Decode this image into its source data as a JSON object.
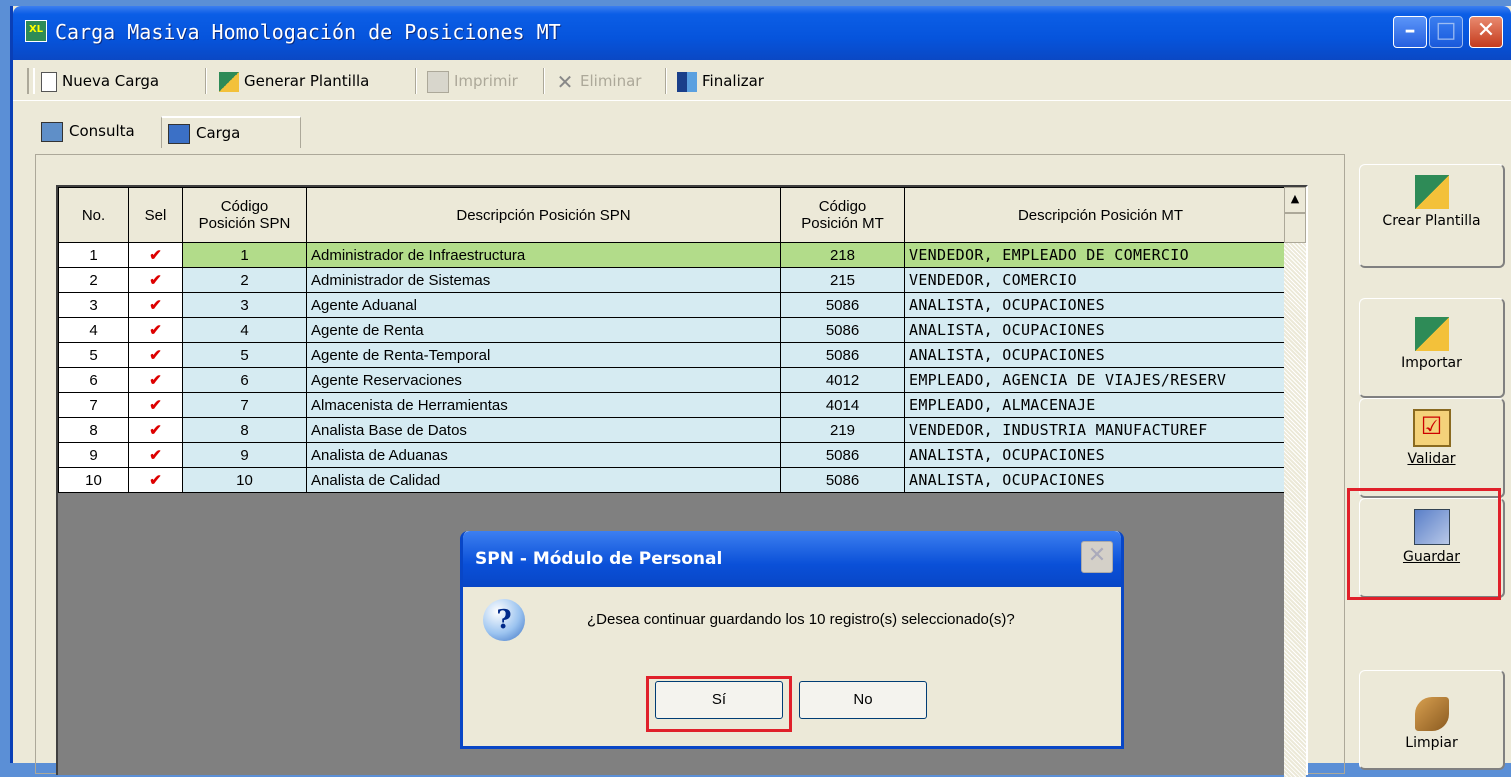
{
  "window": {
    "title": "Carga Masiva Homologación de Posiciones MT"
  },
  "toolbar": {
    "nueva_carga": "Nueva Carga",
    "generar_plantilla": "Generar Plantilla",
    "imprimir": "Imprimir",
    "eliminar": "Eliminar",
    "finalizar": "Finalizar"
  },
  "tabs": [
    {
      "label": "Consulta"
    },
    {
      "label": "Carga"
    }
  ],
  "grid": {
    "headers": [
      "No.",
      "Sel",
      "Código\nPosición SPN",
      "Descripción Posición SPN",
      "Código\nPosición MT",
      "Descripción Posición MT"
    ],
    "rows": [
      {
        "no": "1",
        "sel": "✔",
        "spn_code": "1",
        "spn_desc": "Administrador de Infraestructura",
        "mt_code": "218",
        "mt_desc": "VENDEDOR, EMPLEADO DE COMERCIO"
      },
      {
        "no": "2",
        "sel": "✔",
        "spn_code": "2",
        "spn_desc": "Administrador de Sistemas",
        "mt_code": "215",
        "mt_desc": "VENDEDOR, COMERCIO"
      },
      {
        "no": "3",
        "sel": "✔",
        "spn_code": "3",
        "spn_desc": "Agente Aduanal",
        "mt_code": "5086",
        "mt_desc": "ANALISTA, OCUPACIONES"
      },
      {
        "no": "4",
        "sel": "✔",
        "spn_code": "4",
        "spn_desc": "Agente de Renta",
        "mt_code": "5086",
        "mt_desc": "ANALISTA, OCUPACIONES"
      },
      {
        "no": "5",
        "sel": "✔",
        "spn_code": "5",
        "spn_desc": "Agente de Renta-Temporal",
        "mt_code": "5086",
        "mt_desc": "ANALISTA, OCUPACIONES"
      },
      {
        "no": "6",
        "sel": "✔",
        "spn_code": "6",
        "spn_desc": "Agente Reservaciones",
        "mt_code": "4012",
        "mt_desc": "EMPLEADO, AGENCIA DE VIAJES/RESERV"
      },
      {
        "no": "7",
        "sel": "✔",
        "spn_code": "7",
        "spn_desc": "Almacenista de Herramientas",
        "mt_code": "4014",
        "mt_desc": "EMPLEADO, ALMACENAJE"
      },
      {
        "no": "8",
        "sel": "✔",
        "spn_code": "8",
        "spn_desc": "Analista Base de Datos",
        "mt_code": "219",
        "mt_desc": "VENDEDOR, INDUSTRIA MANUFACTUREF"
      },
      {
        "no": "9",
        "sel": "✔",
        "spn_code": "9",
        "spn_desc": "Analista de Aduanas",
        "mt_code": "5086",
        "mt_desc": "ANALISTA, OCUPACIONES"
      },
      {
        "no": "10",
        "sel": "✔",
        "spn_code": "10",
        "spn_desc": "Analista de Calidad",
        "mt_code": "5086",
        "mt_desc": "ANALISTA, OCUPACIONES"
      }
    ]
  },
  "side_buttons": {
    "crear_plantilla": "Crear Plantilla",
    "importar": "Importar",
    "validar": "Validar",
    "guardar": "Guardar",
    "limpiar": "Limpiar"
  },
  "dialog": {
    "title": "SPN - Módulo de Personal",
    "message": "¿Desea continuar guardando los 10 registro(s) seleccionado(s)?",
    "yes": "Sí",
    "no": "No",
    "icon": "question-icon"
  },
  "colors": {
    "highlight": "#e0202a",
    "selected_row": "#b2dc8a",
    "row_bg": "#d6ebf2"
  }
}
